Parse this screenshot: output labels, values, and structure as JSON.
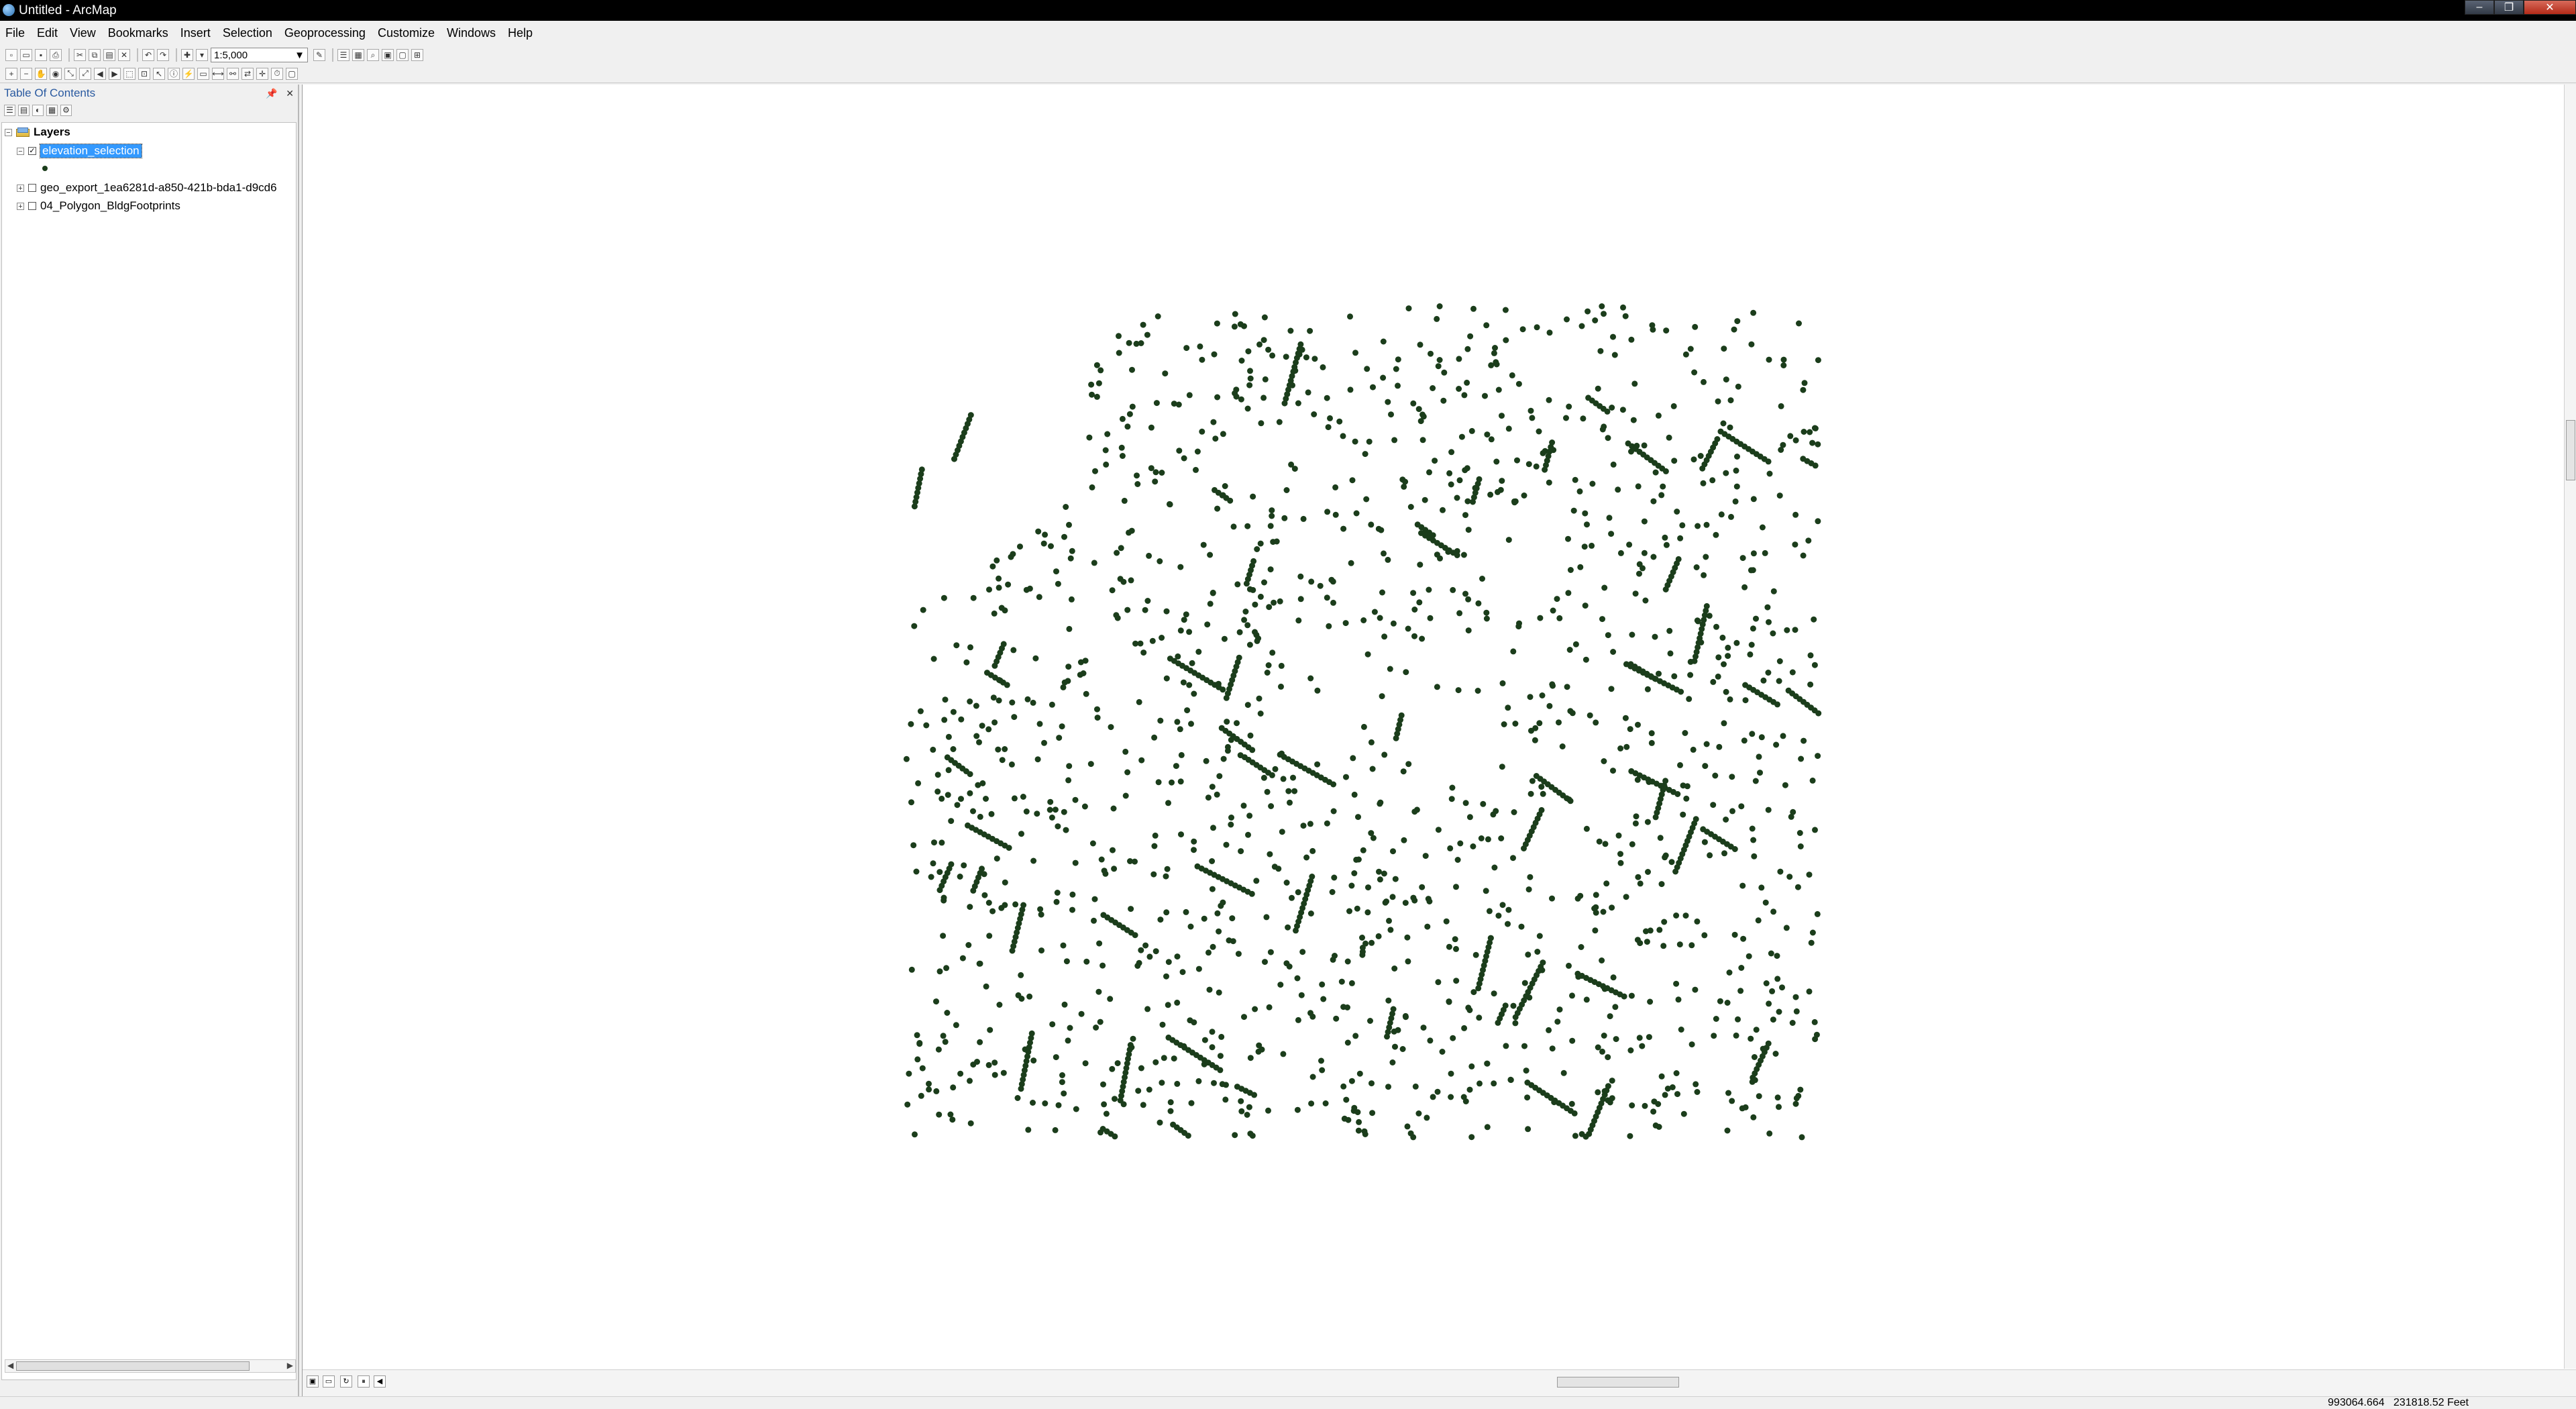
{
  "window": {
    "title": "Untitled - ArcMap"
  },
  "menu": [
    "File",
    "Edit",
    "View",
    "Bookmarks",
    "Insert",
    "Selection",
    "Geoprocessing",
    "Customize",
    "Windows",
    "Help"
  ],
  "toolbar": {
    "scale_value": "1:5,000"
  },
  "toc": {
    "title": "Table Of Contents",
    "root_label": "Layers",
    "layers": [
      {
        "label": "elevation_selection",
        "checked": true,
        "selected": true,
        "expanded": true
      },
      {
        "label": "geo_export_1ea6281d-a850-421b-bda1-d9cd6",
        "checked": false,
        "selected": false,
        "expanded": false
      },
      {
        "label": "04_Polygon_BldgFootprints",
        "checked": false,
        "selected": false,
        "expanded": false
      }
    ]
  },
  "map": {
    "point_color": "#1b3d1b"
  },
  "status": {
    "x": "993064.664",
    "y": "231818.52",
    "units": "Feet"
  }
}
